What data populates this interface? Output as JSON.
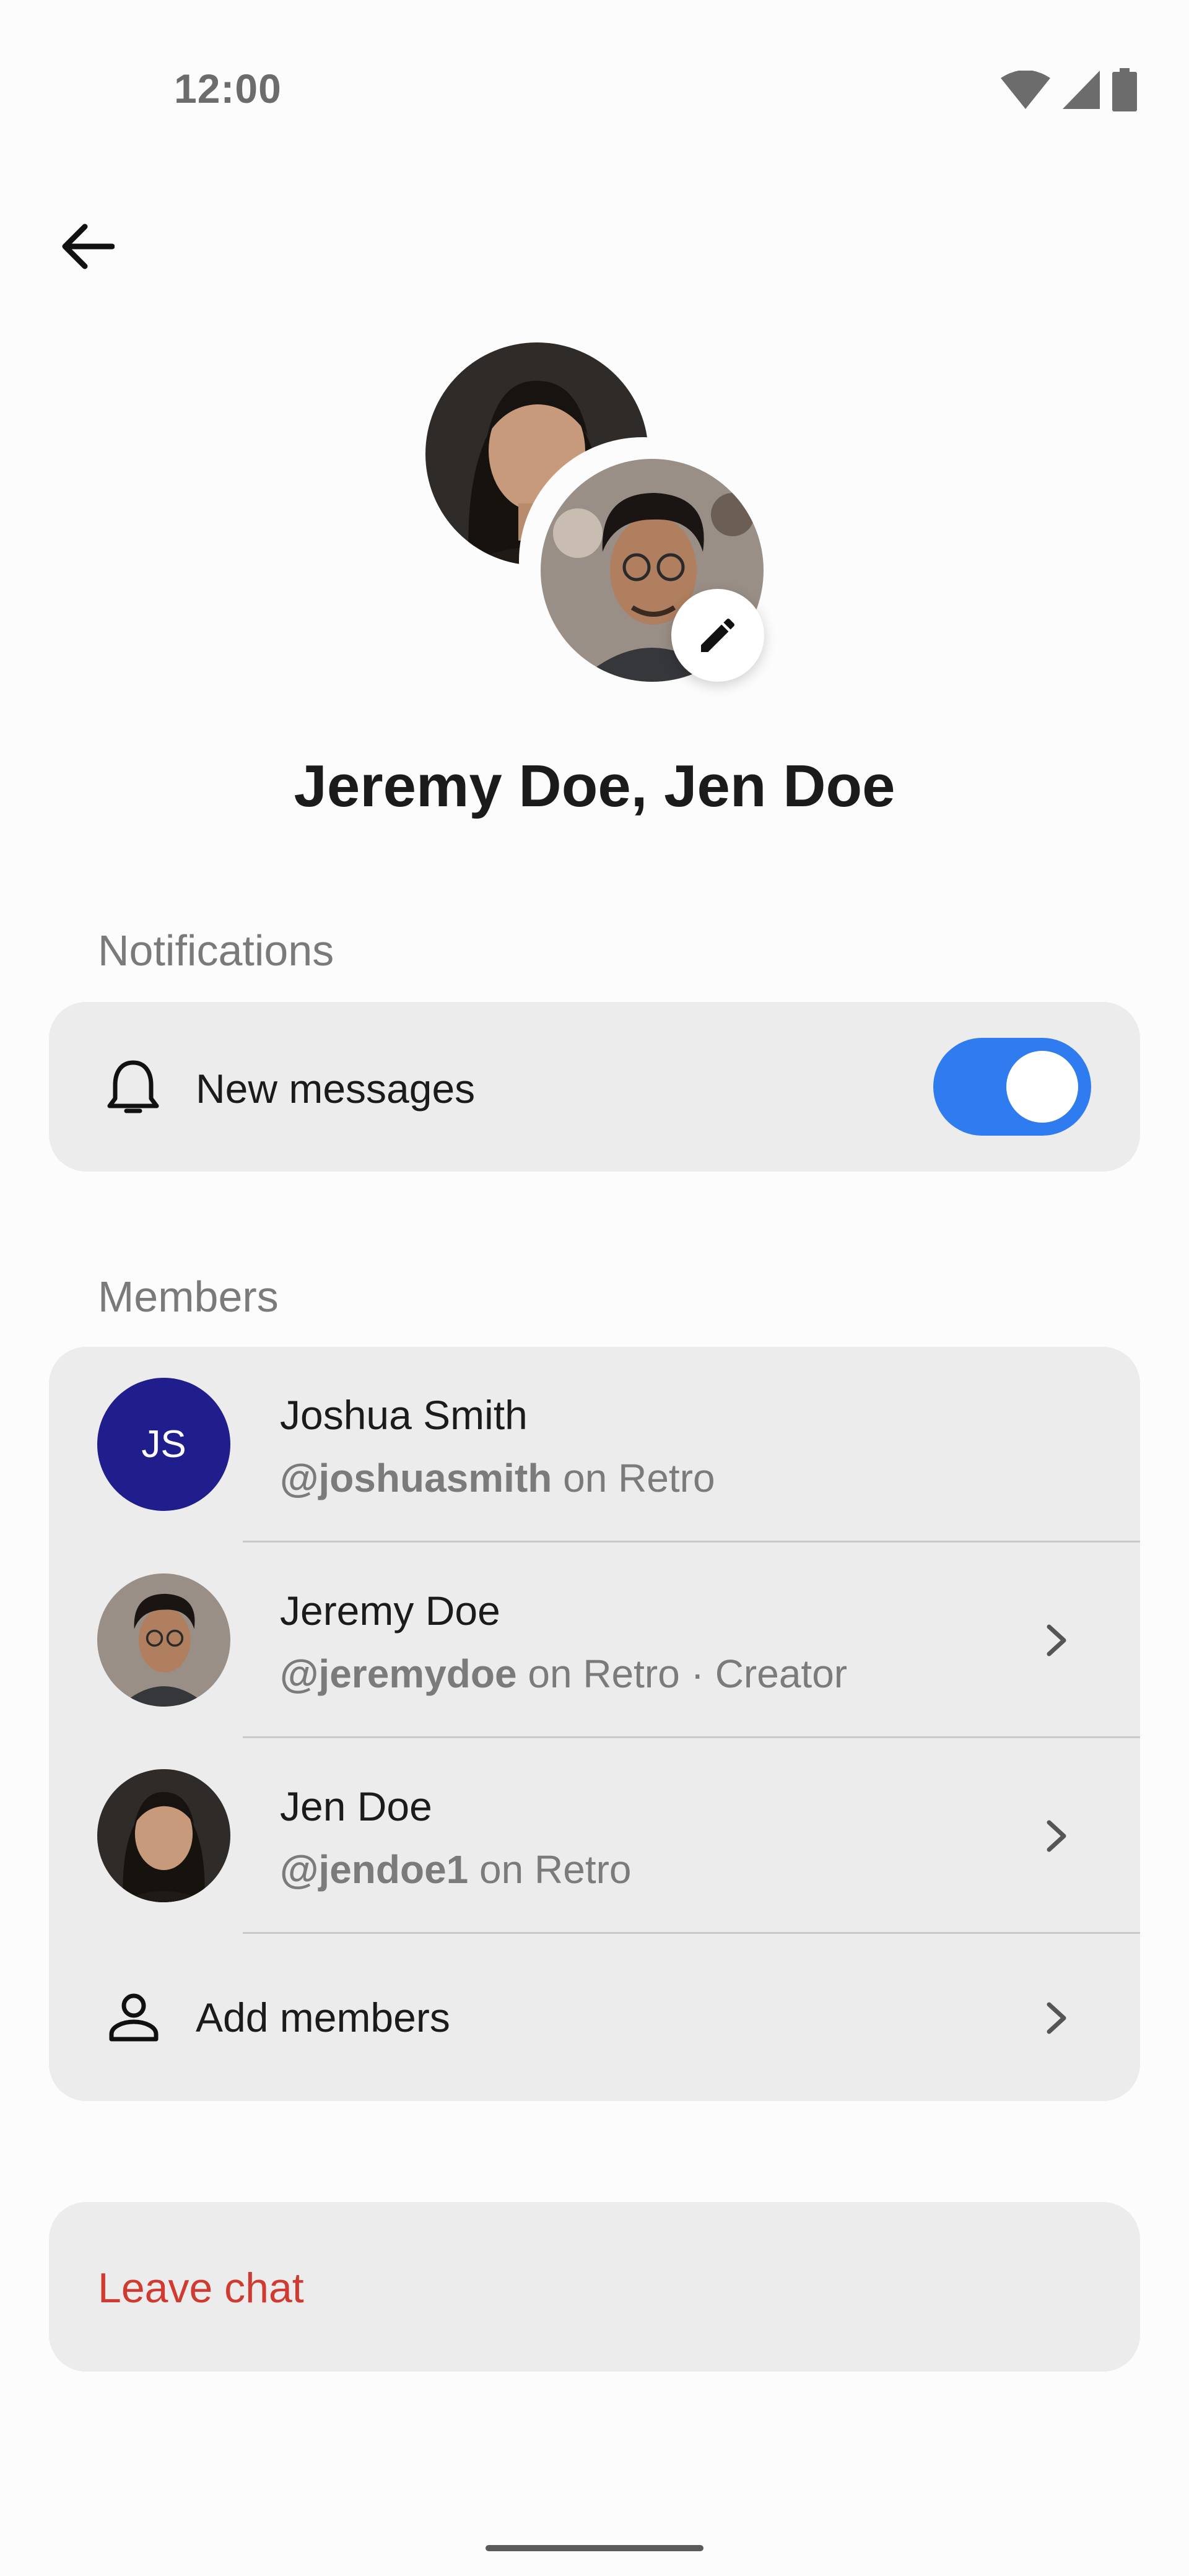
{
  "status_bar": {
    "time": "12:00"
  },
  "header": {
    "back_icon": "arrow-left-icon"
  },
  "chat": {
    "title": "Jeremy Doe, Jen Doe",
    "edit_icon": "pencil-icon"
  },
  "notifications": {
    "section_label": "Notifications",
    "new_messages_label": "New messages",
    "new_messages_enabled": true,
    "icon": "bell-icon"
  },
  "members": {
    "section_label": "Members",
    "items": [
      {
        "name": "Joshua Smith",
        "handle": "@joshuasmith",
        "suffix": " on Retro",
        "initials": "JS"
      },
      {
        "name": "Jeremy Doe",
        "handle": "@jeremydoe",
        "suffix": " on Retro · Creator"
      },
      {
        "name": "Jen Doe",
        "handle": "@jendoe1",
        "suffix": " on Retro"
      }
    ],
    "add_label": "Add members",
    "add_icon": "person-add-icon"
  },
  "actions": {
    "leave_label": "Leave chat"
  },
  "colors": {
    "accent": "#2f7bf0",
    "danger": "#cf3b30",
    "avatar_bg": "#1f1e8c"
  }
}
